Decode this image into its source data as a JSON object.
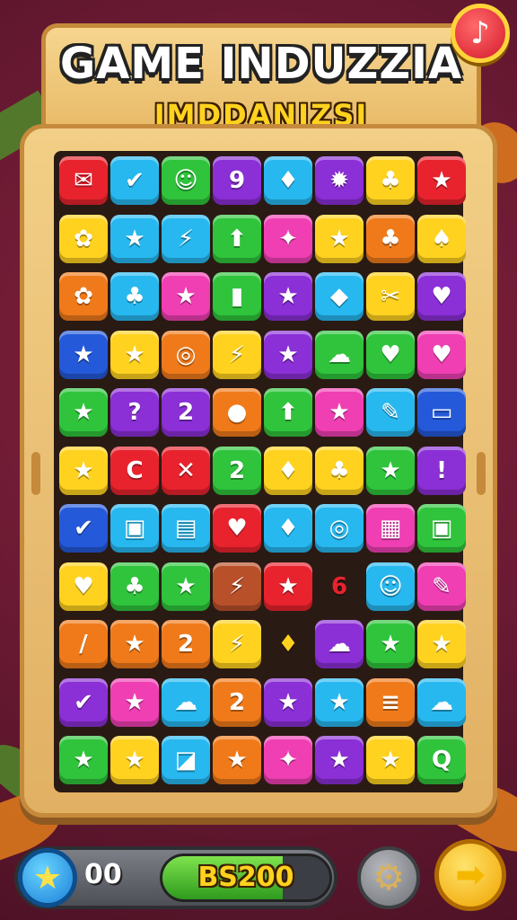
{
  "header": {
    "title": "GAME INDUZZIA",
    "subtitle": "IMDDANIZSI"
  },
  "buttons": {
    "music_icon": "♪",
    "gear_icon": "⚙",
    "next_icon": "➡",
    "star_icon": "★"
  },
  "status": {
    "score": "00",
    "progress_label": "BS200",
    "progress_fraction": 0.72
  },
  "colors": {
    "red": "#e8232e",
    "blue": "#27b8f0",
    "green": "#2fc43c",
    "purple": "#8b2fd6",
    "yellow": "#ffd21f",
    "orange": "#f07a1a",
    "pink": "#ef3fb3",
    "navy": "#2459d9",
    "brown": "#b8502a"
  },
  "board": {
    "rows": [
      [
        [
          "red",
          "✉"
        ],
        [
          "blue",
          "✔"
        ],
        [
          "green",
          "☺"
        ],
        [
          "purple",
          "9"
        ],
        [
          "blue",
          "♦"
        ],
        [
          "purple",
          "✹"
        ],
        [
          "yellow",
          "♣"
        ],
        [
          "red",
          "★"
        ]
      ],
      [
        [
          "yellow",
          "✿"
        ],
        [
          "blue",
          "★"
        ],
        [
          "blue",
          "⚡"
        ],
        [
          "green",
          "⬆"
        ],
        [
          "pink",
          "✦"
        ],
        [
          "yellow",
          "★"
        ],
        [
          "orange",
          "♣"
        ],
        [
          "yellow",
          "♠"
        ]
      ],
      [
        [
          "orange",
          "✿"
        ],
        [
          "blue",
          "♣"
        ],
        [
          "pink",
          "★"
        ],
        [
          "green",
          "▮"
        ],
        [
          "purple",
          "★"
        ],
        [
          "blue",
          "◆"
        ],
        [
          "yellow",
          "✂"
        ],
        [
          "purple",
          "♥"
        ]
      ],
      [
        [
          "navy",
          "★"
        ],
        [
          "yellow",
          "★"
        ],
        [
          "orange",
          "◎"
        ],
        [
          "yellow",
          "⚡"
        ],
        [
          "purple",
          "★"
        ],
        [
          "green",
          "☁"
        ],
        [
          "green",
          "♥"
        ],
        [
          "pink",
          "♥"
        ]
      ],
      [
        [
          "green",
          "★"
        ],
        [
          "purple",
          "?"
        ],
        [
          "purple",
          "2"
        ],
        [
          "orange",
          "●"
        ],
        [
          "green",
          "⬆"
        ],
        [
          "pink",
          "★"
        ],
        [
          "blue",
          "✎"
        ],
        [
          "navy",
          "▭"
        ]
      ],
      [
        [
          "yellow",
          "★"
        ],
        [
          "red",
          "C"
        ],
        [
          "red",
          "✕"
        ],
        [
          "green",
          "2"
        ],
        [
          "yellow",
          "♦"
        ],
        [
          "yellow",
          "♣"
        ],
        [
          "green",
          "★"
        ],
        [
          "purple",
          "!"
        ]
      ],
      [
        [
          "navy",
          "✔"
        ],
        [
          "blue",
          "▣"
        ],
        [
          "blue",
          "▤"
        ],
        [
          "red",
          "♥"
        ],
        [
          "blue",
          "♦"
        ],
        [
          "blue",
          "◎"
        ],
        [
          "pink",
          "▦"
        ],
        [
          "green",
          "▣"
        ]
      ],
      [
        [
          "yellow",
          "♥"
        ],
        [
          "green",
          "♣"
        ],
        [
          "green",
          "★"
        ],
        [
          "brown",
          "⚡"
        ],
        [
          "red",
          "★"
        ],
        [
          "none",
          "6"
        ],
        [
          "blue",
          "☺"
        ],
        [
          "pink",
          "✎"
        ]
      ],
      [
        [
          "orange",
          "/"
        ],
        [
          "orange",
          "★"
        ],
        [
          "orange",
          "2"
        ],
        [
          "yellow",
          "⚡"
        ],
        [
          "none",
          "♦"
        ],
        [
          "purple",
          "☁"
        ],
        [
          "green",
          "★"
        ],
        [
          "yellow",
          "★"
        ]
      ],
      [
        [
          "purple",
          "✔"
        ],
        [
          "pink",
          "★"
        ],
        [
          "blue",
          "☁"
        ],
        [
          "orange",
          "2"
        ],
        [
          "purple",
          "★"
        ],
        [
          "blue",
          "★"
        ],
        [
          "orange",
          "≡"
        ],
        [
          "blue",
          "☁"
        ]
      ],
      [
        [
          "green",
          "★"
        ],
        [
          "yellow",
          "★"
        ],
        [
          "blue",
          "◪"
        ],
        [
          "orange",
          "★"
        ],
        [
          "pink",
          "✦"
        ],
        [
          "purple",
          "★"
        ],
        [
          "yellow",
          "★"
        ],
        [
          "green",
          "Q"
        ]
      ]
    ]
  }
}
